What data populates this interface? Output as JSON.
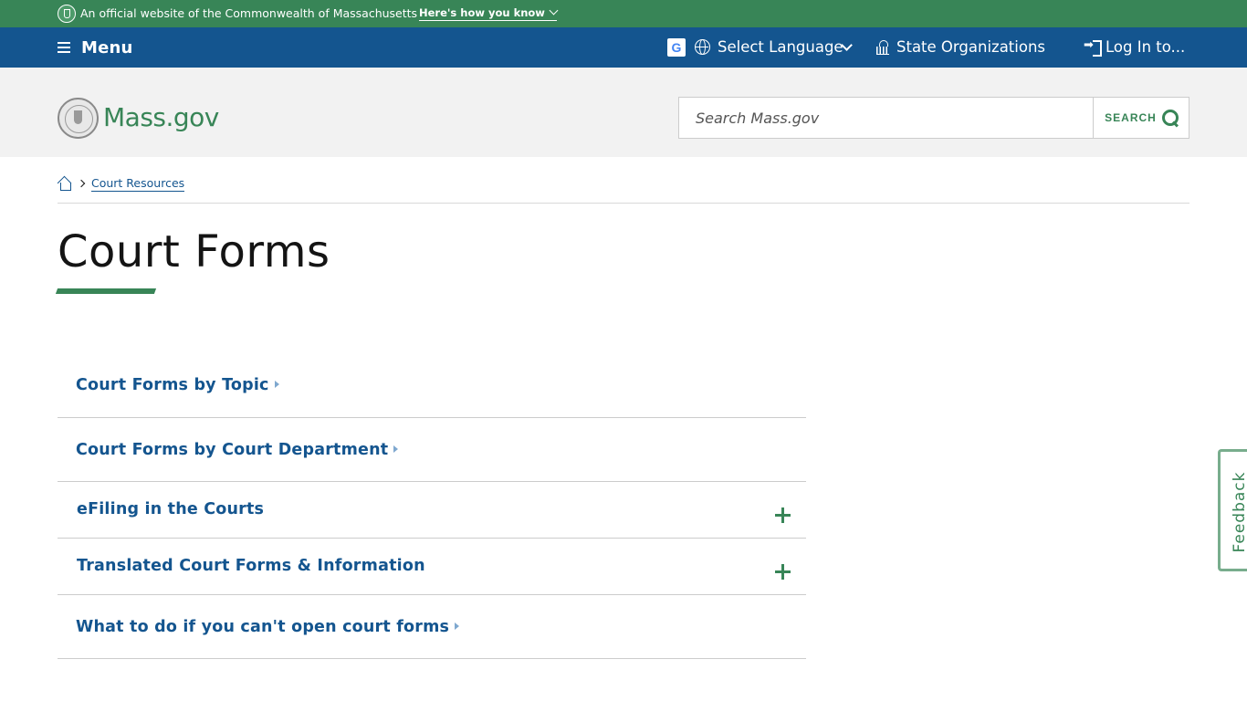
{
  "official_bar": {
    "text": "An official website of the Commonwealth of Massachusetts",
    "how_link": "Here's how you know"
  },
  "nav": {
    "menu_label": "Menu",
    "google_icon_glyph": "G",
    "language_label": "Select Language",
    "orgs_label": "State Organizations",
    "login_label": "Log In to..."
  },
  "header": {
    "site_name": "Mass.gov",
    "search_placeholder": "Search Mass.gov",
    "search_button_label": "SEARCH"
  },
  "breadcrumb": {
    "items": [
      "Court Resources"
    ]
  },
  "page": {
    "title": "Court Forms"
  },
  "links": [
    {
      "label": "Court Forms by Topic",
      "type": "link"
    },
    {
      "label": "Court Forms by Court Department",
      "type": "link"
    },
    {
      "label": "eFiling in the Courts",
      "type": "accordion"
    },
    {
      "label": "Translated Court Forms & Information",
      "type": "accordion"
    },
    {
      "label": "What to do if you can't open court forms",
      "type": "link"
    }
  ],
  "feedback": {
    "label": "Feedback"
  },
  "colors": {
    "official_green": "#388557",
    "nav_blue": "#14558f",
    "header_gray": "#f2f2f2",
    "link_blue": "#14558f"
  }
}
